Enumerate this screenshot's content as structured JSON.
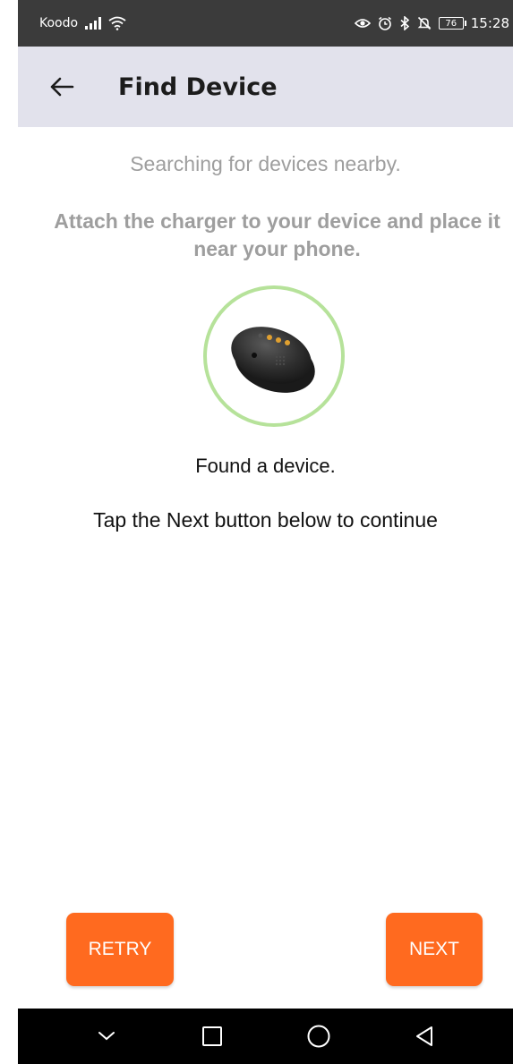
{
  "status_bar": {
    "carrier": "Koodo",
    "battery": "76",
    "time": "15:28",
    "icons": [
      "signal-icon",
      "wifi-icon",
      "eye-icon",
      "alarm-icon",
      "bluetooth-icon",
      "mute-icon",
      "battery-icon"
    ]
  },
  "app_bar": {
    "title": "Find Device",
    "back_icon": "back-arrow-icon",
    "background": "#e2e2ec"
  },
  "content": {
    "searching_text": "Searching for devices nearby.",
    "attach_text": "Attach the charger to your device and place it near your phone.",
    "found_text": "Found a device.",
    "instruction_text": "Tap the Next button below to continue",
    "ring_color": "#b6e29a"
  },
  "buttons": {
    "retry_label": "RETRY",
    "next_label": "NEXT",
    "color": "#ff6a1f"
  },
  "nav_bar": {
    "icons": [
      "chevron-down-icon",
      "square-icon",
      "circle-icon",
      "triangle-back-icon"
    ]
  }
}
